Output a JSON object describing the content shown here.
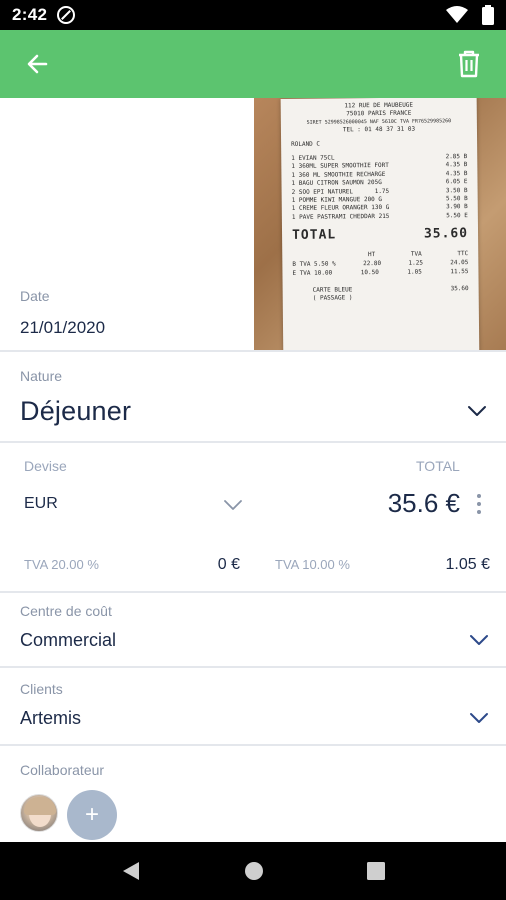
{
  "status_bar": {
    "time": "2:42"
  },
  "app_bar": {
    "back_icon": "arrow-left-icon",
    "delete_icon": "trash-icon"
  },
  "receipt": {
    "header_lines": [
      "112 RUE DE MAUBEUGE",
      "75010 PARIS FRANCE",
      "SIRET 52998526000045 NAF 5610C TVA FR76529985260",
      "TEL : 01 48 37 31 03"
    ],
    "operator": "ROLAND C",
    "items": [
      {
        "label": "1 EVIAN 75CL",
        "price": "2.85 B"
      },
      {
        "label": "1 360ML SUPER SMOOTHIE FORT",
        "price": "4.35 B"
      },
      {
        "label": "1 360 ML SMOOTHIE RECHARGE",
        "price": "4.35 B"
      },
      {
        "label": "1 BAGU CITRON SAUMON 205G",
        "price": "6.05 E"
      },
      {
        "label": "2 SOO EPI NATUREL      1.75",
        "price": "3.50 B"
      },
      {
        "label": "1 POMME KIWI MANGUE 200 G",
        "price": "5.50 B"
      },
      {
        "label": "1 CREME FLEUR ORANGER 130 G",
        "price": "3.90 B"
      },
      {
        "label": "1 PAVE PASTRAMI CHEDDAR 215",
        "price": "5.50 E"
      }
    ],
    "total_label": "TOTAL",
    "total_value": "35.60",
    "tax_header": [
      "",
      "HT",
      "TVA",
      "TTC"
    ],
    "tax_rows": [
      [
        "B TVA 5.50 %",
        "22.80",
        "1.25",
        "24.05"
      ],
      [
        "E TVA 10.00",
        "10.50",
        "1.05",
        "11.55"
      ]
    ],
    "payment": [
      "CARTE BLEUE",
      "35.60"
    ],
    "footer": "( PASSAGE )"
  },
  "date": {
    "label": "Date",
    "value": "21/01/2020"
  },
  "nature": {
    "label": "Nature",
    "value": "Déjeuner"
  },
  "devise": {
    "label": "Devise",
    "value": "EUR"
  },
  "total": {
    "label": "TOTAL",
    "value": "35.6 €"
  },
  "tva": [
    {
      "label": "TVA 20.00 %",
      "value": "0 €"
    },
    {
      "label": "TVA 10.00 %",
      "value": "1.05 €"
    }
  ],
  "centre_de_cout": {
    "label": "Centre de coût",
    "value": "Commercial"
  },
  "clients": {
    "label": "Clients",
    "value": "Artemis"
  },
  "collaborateur": {
    "label": "Collaborateur",
    "add_symbol": "+"
  },
  "colors": {
    "accent": "#5cc46f",
    "text_dark": "#1c2a48",
    "label_grey": "#8a95a8",
    "add_button": "#a9b8cc"
  }
}
